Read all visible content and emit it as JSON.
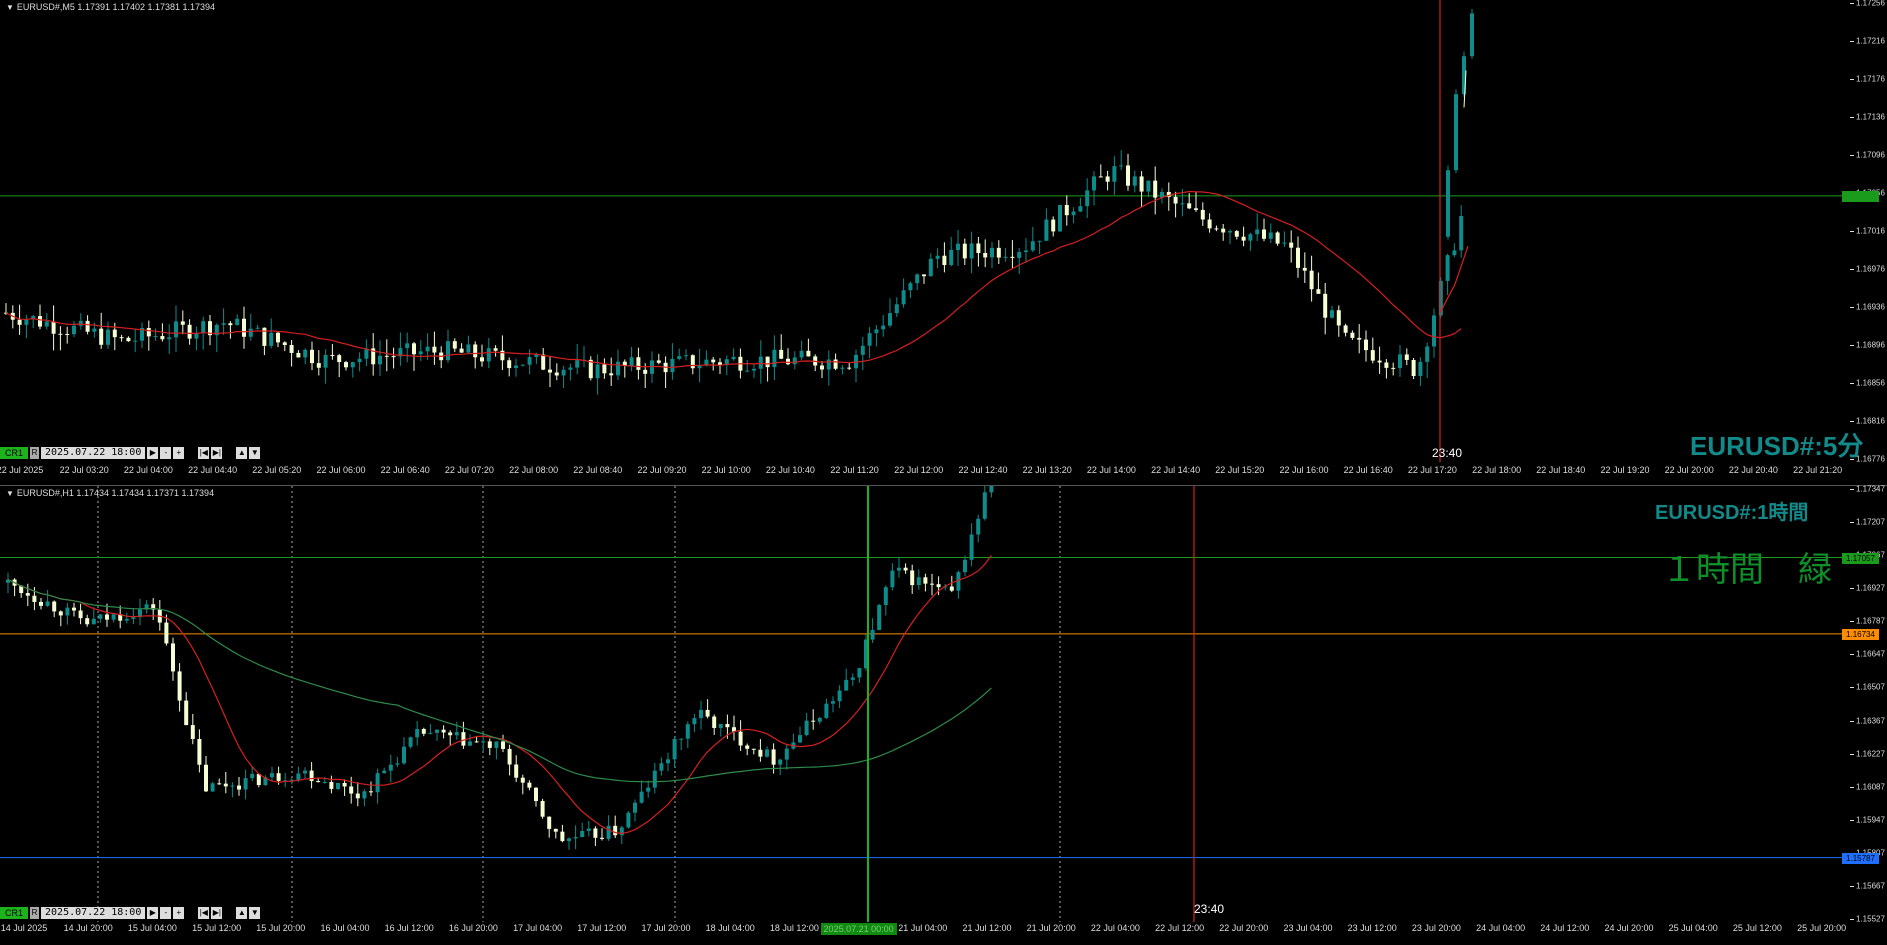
{
  "top_chart": {
    "caption": "EURUSD#,M5  1.17391 1.17402 1.17381 1.17394",
    "watermark": "EURUSD#:5分",
    "cursor_time": "23:40",
    "controls": {
      "cr_label": "CR1",
      "r_label": "R",
      "datetime": "2025.07.22 18:00"
    },
    "green_line_price": 1.17053,
    "price_min": 1.16776,
    "price_max": 1.17256,
    "y_ticks": [
      "1.17256",
      "1.17216",
      "1.17176",
      "1.17136",
      "1.17096",
      "1.17056",
      "1.17016",
      "1.16976",
      "1.16936",
      "1.16896",
      "1.16856",
      "1.16816",
      "1.16776"
    ],
    "x_labels": [
      "22 Jul 2025",
      "22 Jul 03:20",
      "22 Jul 04:00",
      "22 Jul 04:40",
      "22 Jul 05:20",
      "22 Jul 06:00",
      "22 Jul 06:40",
      "22 Jul 07:20",
      "22 Jul 08:00",
      "22 Jul 08:40",
      "22 Jul 09:20",
      "22 Jul 10:00",
      "22 Jul 10:40",
      "22 Jul 11:20",
      "22 Jul 12:00",
      "22 Jul 12:40",
      "22 Jul 13:20",
      "22 Jul 14:00",
      "22 Jul 14:40",
      "22 Jul 15:20",
      "22 Jul 16:00",
      "22 Jul 16:40",
      "22 Jul 17:20",
      "22 Jul 18:00",
      "22 Jul 18:40",
      "22 Jul 19:20",
      "22 Jul 20:00",
      "22 Jul 20:40",
      "22 Jul 21:20"
    ],
    "colors": {
      "bull": "#0e8c8c",
      "bear": "#f4ffd4",
      "ma": "#d62020",
      "hline": "#1b9b1b",
      "cursor": "#d62020",
      "price_tag": "#1b9b1b"
    }
  },
  "bottom_chart": {
    "caption": "EURUSD#,H1  1.17434 1.17434 1.17371 1.17394",
    "watermark": "EURUSD#:1時間",
    "label_1h": "１時間　緑",
    "cursor_time": "23:40",
    "controls": {
      "cr_label": "CR1",
      "r_label": "R",
      "datetime": "2025.07.22 18:00"
    },
    "price_min": 1.15527,
    "price_max": 1.17347,
    "y_ticks": [
      "1.17347",
      "1.17207",
      "1.17067",
      "1.16927",
      "1.16787",
      "1.16647",
      "1.16507",
      "1.16367",
      "1.16227",
      "1.16087",
      "1.15947",
      "1.15807",
      "1.15667",
      "1.15527"
    ],
    "hlines": [
      {
        "price": 1.17057,
        "color": "#1b9b1b",
        "tag": "1.17057"
      },
      {
        "price": 1.16734,
        "color": "#ff8c00",
        "tag": "1.16734"
      },
      {
        "price": 1.15787,
        "color": "#1e6fff",
        "tag": "1.15787"
      }
    ],
    "x_labels": [
      "14 Jul 2025",
      "14 Jul 20:00",
      "15 Jul 04:00",
      "15 Jul 12:00",
      "15 Jul 20:00",
      "16 Jul 04:00",
      "16 Jul 12:00",
      "16 Jul 20:00",
      "17 Jul 04:00",
      "17 Jul 12:00",
      "17 Jul 20:00",
      "18 Jul 04:00",
      "18 Jul 12:00",
      "2025.07.21 00:00",
      "21 Jul 04:00",
      "21 Jul 12:00",
      "21 Jul 20:00",
      "22 Jul 04:00",
      "22 Jul 12:00",
      "22 Jul 20:00",
      "23 Jul 04:00",
      "23 Jul 12:00",
      "23 Jul 20:00",
      "24 Jul 04:00",
      "24 Jul 12:00",
      "24 Jul 20:00",
      "25 Jul 04:00",
      "25 Jul 12:00",
      "25 Jul 20:00"
    ],
    "colors": {
      "bull": "#0e8c8c",
      "bear": "#f4ffd4",
      "ma_fast": "#d62020",
      "ma_slow": "#2e8b4a",
      "cursor": "#d62020",
      "vline": "#1db31d"
    }
  }
}
